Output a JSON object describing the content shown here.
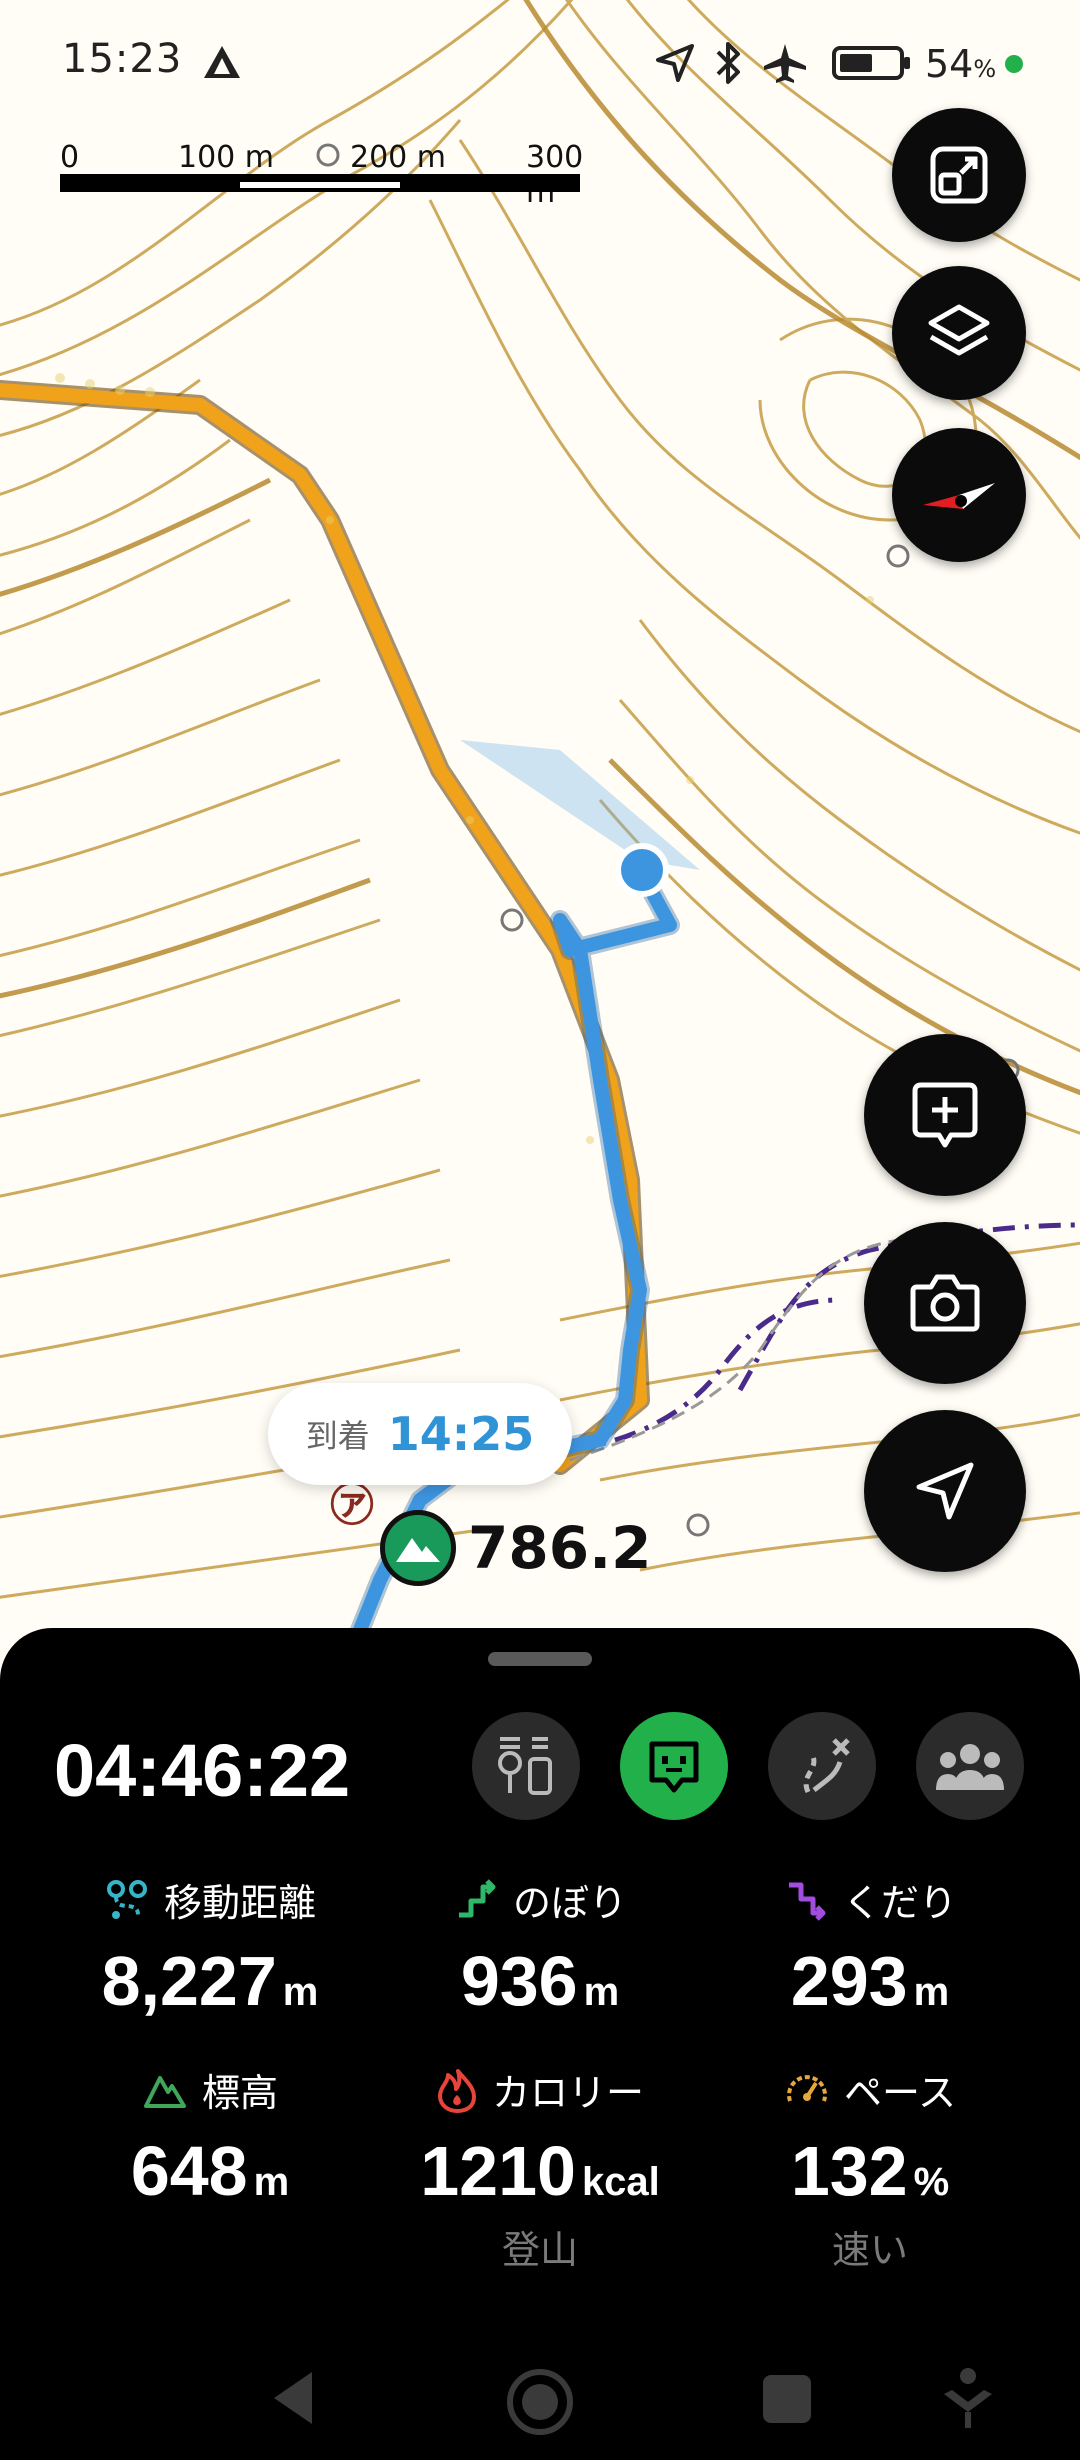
{
  "status_bar": {
    "time": "15:23",
    "battery": "54",
    "battery_unit": "%"
  },
  "scale_bar": {
    "labels": [
      "0",
      "100 m",
      "200 m",
      "300 m"
    ]
  },
  "map": {
    "arrival_label": "到着",
    "arrival_time": "14:25",
    "peak_elevation": "786.2"
  },
  "panel": {
    "elapsed_time": "04:46:22",
    "stats": [
      {
        "label": "移動距離",
        "value": "8,227",
        "unit": "m",
        "icon": "distance-icon",
        "color": "#35b5c8"
      },
      {
        "label": "のぼり",
        "value": "936",
        "unit": "m",
        "icon": "ascent-icon",
        "color": "#2fb86a"
      },
      {
        "label": "くだり",
        "value": "293",
        "unit": "m",
        "icon": "descent-icon",
        "color": "#a24de0"
      },
      {
        "label": "標高",
        "value": "648",
        "unit": "m",
        "icon": "mountain-icon",
        "color": "#3fa65a"
      },
      {
        "label": "カロリー",
        "value": "1210",
        "unit": "kcal",
        "icon": "flame-icon",
        "color": "#e8443a",
        "sub": "登山"
      },
      {
        "label": "ペース",
        "value": "132",
        "unit": "%",
        "icon": "speedometer-icon",
        "color": "#e5a83a",
        "sub": "速い"
      }
    ]
  },
  "colors": {
    "route_orange": "#f0a21a",
    "track_blue": "#3d95e0",
    "contour": "#c8a050",
    "accent_green": "#22b04b"
  }
}
